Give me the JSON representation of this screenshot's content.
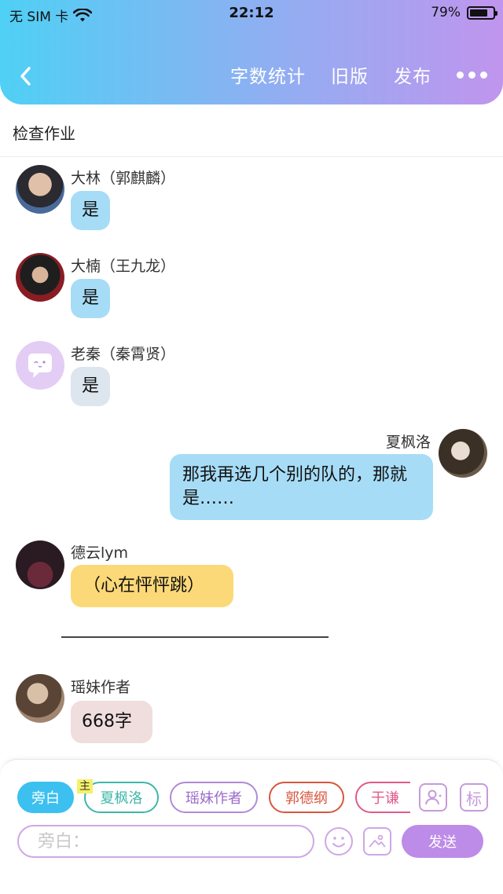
{
  "status_bar": {
    "carrier": "无 SIM 卡",
    "time": "22:12",
    "battery_text": "79%",
    "battery_level": 0.79
  },
  "nav": {
    "back_icon": "chevron-left-icon",
    "actions": [
      "字数统计",
      "旧版",
      "发布"
    ],
    "more_icon": "more-dots-icon"
  },
  "page_title": "检查作业",
  "messages": [
    {
      "sender": "大林（郭麒麟）",
      "text": "是",
      "side": "left",
      "bubble_color": "#a7dcf6"
    },
    {
      "sender": "大楠（王九龙）",
      "text": "是",
      "side": "left",
      "bubble_color": "#a7dcf6"
    },
    {
      "sender": "老秦（秦霄贤）",
      "text": "是",
      "side": "left",
      "bubble_color": "#dde5ee"
    },
    {
      "sender": "夏枫洛",
      "text": "那我再选几个别的队的，那就是……",
      "side": "right",
      "bubble_color": "#a7dcf6"
    },
    {
      "sender": "德云lym",
      "text": "（心在怦怦跳）",
      "side": "left",
      "bubble_color": "#fcd978"
    },
    {
      "divider": "————————————"
    },
    {
      "sender": "瑶妹作者",
      "text": "668字",
      "side": "left",
      "bubble_color": "#f0dddd"
    }
  ],
  "composer": {
    "roles": [
      {
        "label": "旁白",
        "active": true,
        "color": "#3cc0f0"
      },
      {
        "label": "夏枫洛",
        "active": false,
        "color": "#3fb7a8"
      },
      {
        "label": "瑶妹作者",
        "active": false,
        "color": "#b08ad8"
      },
      {
        "label": "郭德纲",
        "active": false,
        "color": "#d8563e"
      },
      {
        "label": "于谦",
        "active": false,
        "color": "#e05a8c"
      }
    ],
    "main_tag": "主",
    "contacts_icon": "person-card-icon",
    "tag_button_label": "标",
    "input_placeholder": "旁白：",
    "emoji_icon": "emoji-icon",
    "image_icon": "image-icon",
    "send_label": "发送"
  },
  "colors": {
    "accent": "#bd8be8",
    "header_start": "#4fd0f5",
    "header_end": "#c095ee"
  }
}
